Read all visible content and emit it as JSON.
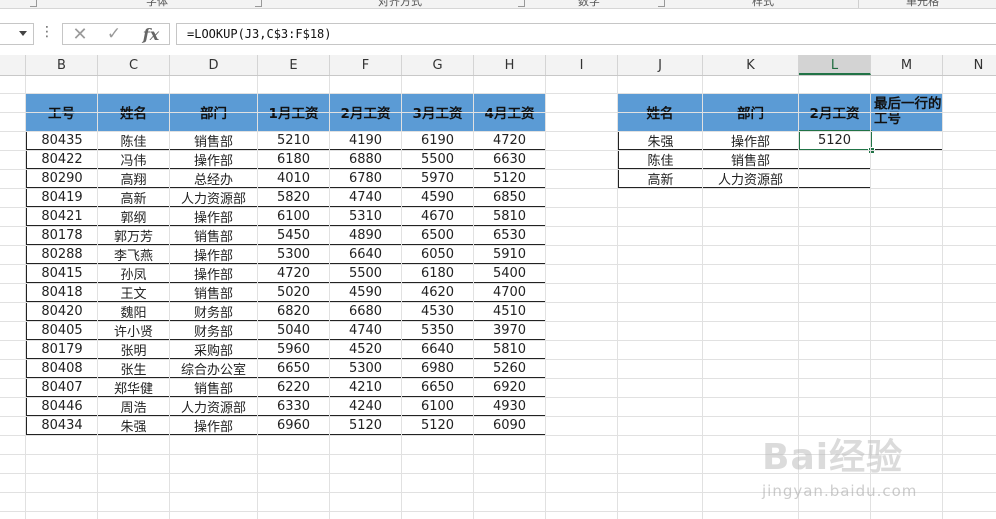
{
  "ribbon": {
    "groups": [
      "字体",
      "对齐方式",
      "数字",
      "样式",
      "单元格"
    ]
  },
  "formula_bar": {
    "formula": "=LOOKUP(J3,C$3:F$18)"
  },
  "columns": [
    "B",
    "C",
    "D",
    "E",
    "F",
    "G",
    "H",
    "I",
    "J",
    "K",
    "L",
    "M",
    "N"
  ],
  "selected_column": "L",
  "main_table": {
    "headers": [
      "工号",
      "姓名",
      "部门",
      "1月工资",
      "2月工资",
      "3月工资",
      "4月工资"
    ],
    "rows": [
      [
        "80435",
        "陈佳",
        "销售部",
        "5210",
        "4190",
        "6190",
        "4720"
      ],
      [
        "80422",
        "冯伟",
        "操作部",
        "6180",
        "6880",
        "5500",
        "6630"
      ],
      [
        "80290",
        "高翔",
        "总经办",
        "4010",
        "6780",
        "5970",
        "5120"
      ],
      [
        "80419",
        "高新",
        "人力资源部",
        "5820",
        "4740",
        "4590",
        "6850"
      ],
      [
        "80421",
        "郭纲",
        "操作部",
        "6100",
        "5310",
        "4670",
        "5810"
      ],
      [
        "80178",
        "郭万芳",
        "销售部",
        "5450",
        "4890",
        "6500",
        "6530"
      ],
      [
        "80288",
        "李飞燕",
        "操作部",
        "5300",
        "6640",
        "6050",
        "5910"
      ],
      [
        "80415",
        "孙凤",
        "操作部",
        "4720",
        "5500",
        "6180",
        "5400"
      ],
      [
        "80418",
        "王文",
        "销售部",
        "5020",
        "4590",
        "4620",
        "4700"
      ],
      [
        "80420",
        "魏阳",
        "财务部",
        "6820",
        "6680",
        "4530",
        "4510"
      ],
      [
        "80405",
        "许小贤",
        "财务部",
        "5040",
        "4740",
        "5350",
        "3970"
      ],
      [
        "80179",
        "张明",
        "采购部",
        "5960",
        "4520",
        "6640",
        "5810"
      ],
      [
        "80408",
        "张生",
        "综合办公室",
        "6650",
        "5300",
        "6980",
        "5260"
      ],
      [
        "80407",
        "郑华健",
        "销售部",
        "6220",
        "4210",
        "6650",
        "6920"
      ],
      [
        "80446",
        "周浩",
        "人力资源部",
        "6330",
        "4240",
        "6100",
        "4930"
      ],
      [
        "80434",
        "朱强",
        "操作部",
        "6960",
        "5120",
        "5120",
        "6090"
      ]
    ]
  },
  "lookup_table": {
    "headers": [
      "姓名",
      "部门",
      "2月工资",
      "最后一行的工号"
    ],
    "rows": [
      [
        "朱强",
        "操作部",
        "5120",
        ""
      ],
      [
        "陈佳",
        "销售部",
        "",
        ""
      ],
      [
        "高新",
        "人力资源部",
        "",
        ""
      ]
    ]
  },
  "watermark": {
    "logo": "Bai经验",
    "url": "jingyan.baidu.com"
  }
}
